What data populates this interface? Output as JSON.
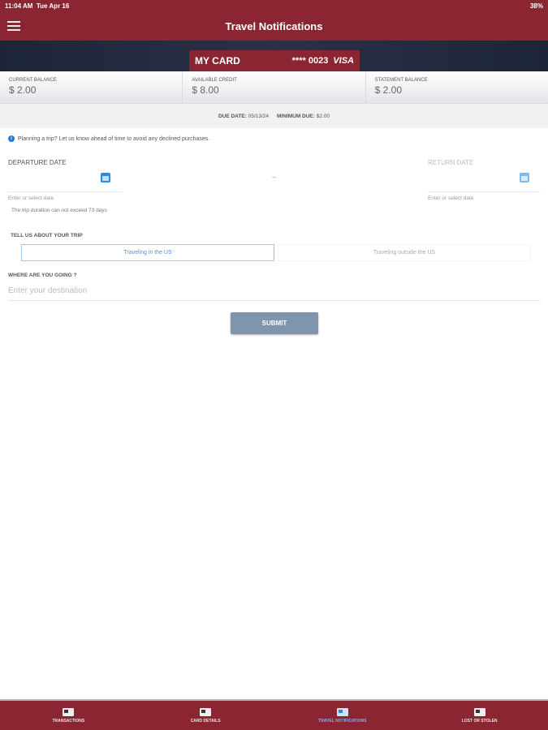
{
  "status": {
    "time": "11:04 AM",
    "date": "Tue Apr 16",
    "battery": "38%"
  },
  "header": {
    "title": "Travel Notifications"
  },
  "card": {
    "name": "MY CARD",
    "number": "**** 0023",
    "brand": "VISA"
  },
  "balances": [
    {
      "label": "CURRENT BALANCE",
      "value": "$ 2.00"
    },
    {
      "label": "AVAILABLE CREDIT",
      "value": "$ 8.00"
    },
    {
      "label": "STATEMENT BALANCE",
      "value": "$ 2.00"
    }
  ],
  "due": {
    "date_label": "DUE DATE:",
    "date": "05/13/24",
    "min_label": "MINIMUM DUE:",
    "min": "$2.00"
  },
  "info": "Planning a trip? Let us know ahead of time to avoid any declined purchases.",
  "form": {
    "departure_label": "DEPARTURE DATE",
    "return_label": "RETURN DATE",
    "separator": "--",
    "date_hint": "Enter or select date",
    "duration_note": "The trip duration can not exceed 73 days",
    "trip_label": "TELL US ABOUT YOUR TRIP",
    "trip_options": [
      "Traveling in the US",
      "Traveling outside the US"
    ],
    "destination_label": "WHERE ARE YOU GOING ?",
    "destination_placeholder": "Enter your destination",
    "submit": "SUBMIT"
  },
  "tabs": [
    "TRANSACTIONS",
    "CARD DETAILS",
    "TRAVEL NOTIFICATIONS",
    "LOST OR STOLEN"
  ],
  "colors": {
    "brand": "#8a2531",
    "accent": "#2a8be0"
  }
}
